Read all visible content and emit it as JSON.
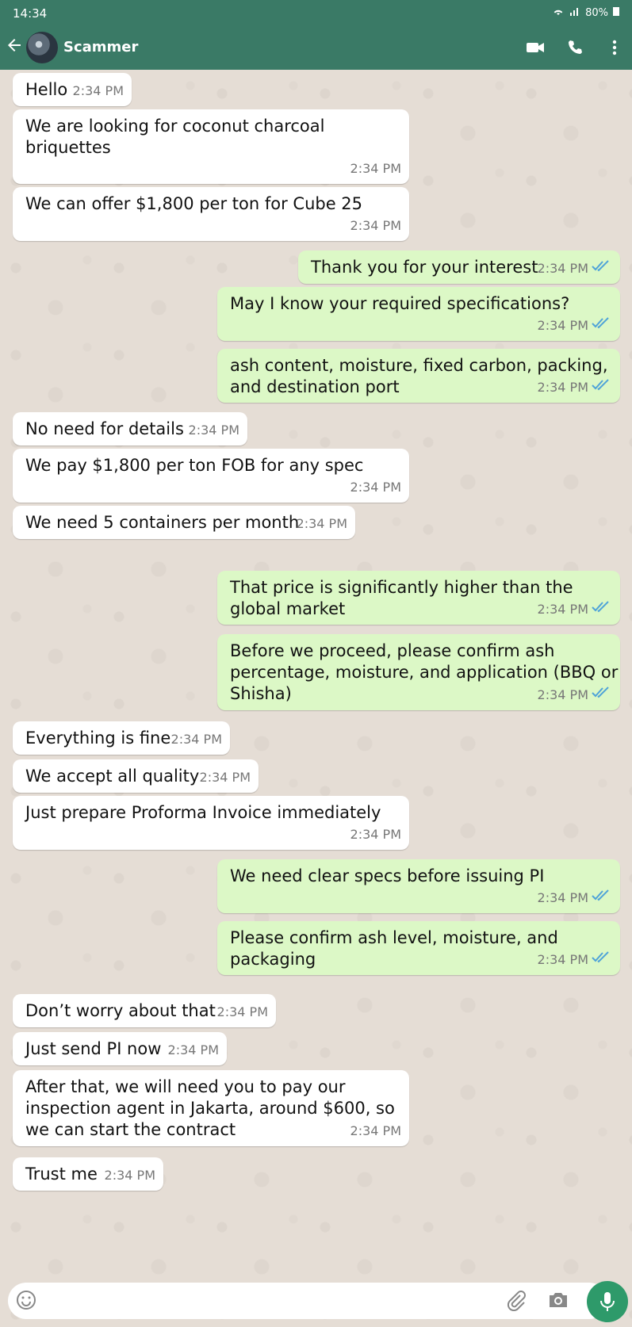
{
  "status": {
    "time": "14:34",
    "battery": "80%"
  },
  "header": {
    "contact_name": "Scammer"
  },
  "messages": [
    {
      "dir": "in",
      "text": "Hello",
      "time": "2:34 PM"
    },
    {
      "dir": "in",
      "text": "We are looking for coconut charcoal\nbriquettes",
      "time": "2:34 PM"
    },
    {
      "dir": "in",
      "text": "We can offer $1,800 per ton for Cube 25",
      "time": "2:34 PM"
    },
    {
      "dir": "out",
      "text": "Thank you for your interest",
      "time": "2:34 PM"
    },
    {
      "dir": "out",
      "text": "May I know your required specifications?",
      "time": "2:34 PM"
    },
    {
      "dir": "out",
      "text": "ash content, moisture, fixed carbon, packing,\nand destination port",
      "time": "2:34 PM"
    },
    {
      "dir": "in",
      "text": "No need for details",
      "time": "2:34 PM"
    },
    {
      "dir": "in",
      "text": "We pay $1,800 per ton FOB for any spec",
      "time": "2:34 PM"
    },
    {
      "dir": "in",
      "text": "We need 5 containers per month",
      "time": "2:34 PM"
    },
    {
      "dir": "out",
      "text": "That price is significantly higher than the\nglobal market",
      "time": "2:34 PM"
    },
    {
      "dir": "out",
      "text": "Before we proceed, please confirm ash\npercentage, moisture, and application (BBQ or\nShisha)",
      "time": "2:34 PM"
    },
    {
      "dir": "in",
      "text": "Everything is fine",
      "time": "2:34 PM"
    },
    {
      "dir": "in",
      "text": "We accept all quality",
      "time": "2:34 PM"
    },
    {
      "dir": "in",
      "text": "Just prepare Proforma Invoice immediately",
      "time": "2:34 PM"
    },
    {
      "dir": "out",
      "text": "We need clear specs before issuing PI",
      "time": "2:34 PM"
    },
    {
      "dir": "out",
      "text": "Please confirm ash level, moisture, and\npackaging",
      "time": "2:34 PM"
    },
    {
      "dir": "in",
      "text": "Don’t worry about that",
      "time": "2:34 PM"
    },
    {
      "dir": "in",
      "text": "Just send PI now",
      "time": "2:34 PM"
    },
    {
      "dir": "in",
      "text": "After that, we will need you to pay our\ninspection agent in Jakarta, around $600, so\nwe can start the contract",
      "time": "2:34 PM"
    },
    {
      "dir": "in",
      "text": "Trust me",
      "time": "2:34 PM"
    }
  ],
  "colors": {
    "header": "#3a7a66",
    "incoming": "#ffffff",
    "outgoing": "#dcf8c6",
    "read_tick": "#4fa3d8",
    "mic_button": "#2e9a6a"
  },
  "icons": [
    "back-arrow-icon",
    "video-call-icon",
    "phone-icon",
    "more-options-icon",
    "emoji-icon",
    "attach-icon",
    "camera-icon",
    "mic-icon"
  ]
}
